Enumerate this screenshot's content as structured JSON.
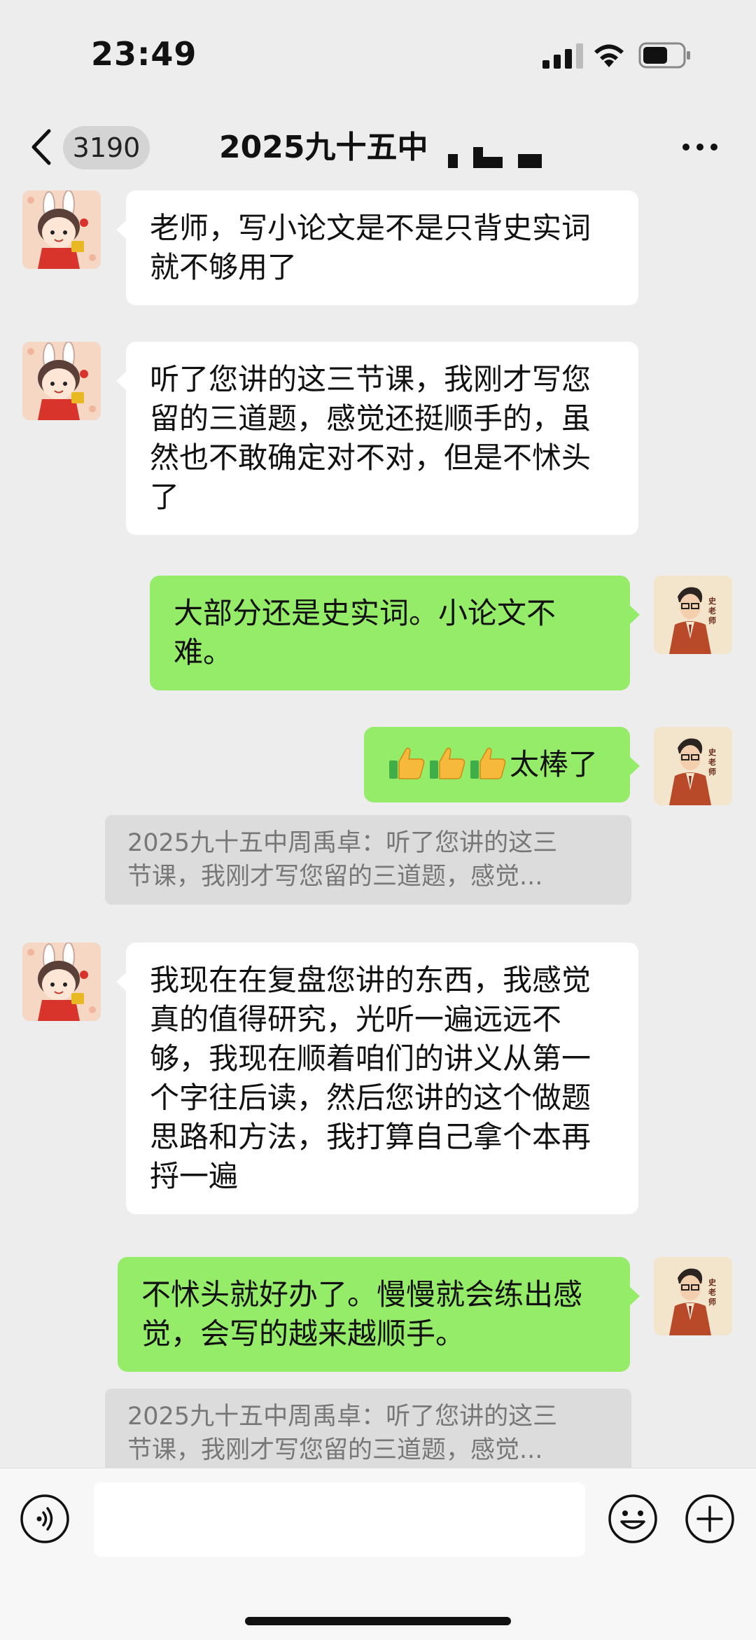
{
  "status_bar": {
    "time": "23:49"
  },
  "header": {
    "unread_count": "3190",
    "title": "2025九十五中"
  },
  "messages": [
    {
      "sender": "student",
      "text": "老师，写小论文是不是只背史实词就不够用了"
    },
    {
      "sender": "student",
      "text": "听了您讲的这三节课，我刚才写您留的三道题，感觉还挺顺手的，虽然也不敢确定对不对，但是不怵头了"
    },
    {
      "sender": "teacher",
      "text": "大部分还是史实词。小论文不难。"
    },
    {
      "sender": "teacher",
      "text": "太棒了",
      "emoji": [
        "thumbs-up",
        "thumbs-up",
        "thumbs-up"
      ]
    },
    {
      "quote": [
        "2025九十五中周禹卓：听了您讲的这三",
        "节课，我刚才写您留的三道题，感觉..."
      ]
    },
    {
      "sender": "student",
      "text": "我现在在复盘您讲的东西，我感觉真的值得研究，光听一遍远远不够，我现在顺着咱们的讲义从第一个字往后读，然后您讲的这个做题思路和方法，我打算自己拿个本再捋一遍"
    },
    {
      "sender": "teacher",
      "text": "不怵头就好办了。慢慢就会练出感觉，会写的越来越顺手。"
    },
    {
      "quote": [
        "2025九十五中周禹卓：听了您讲的这三",
        "节课，我刚才写您留的三道题，感觉..."
      ]
    }
  ],
  "teacher_avatar_label": "史老师",
  "input": {
    "value": ""
  },
  "colors": {
    "background": "#ededed",
    "outgoing_bubble": "#95ec69",
    "incoming_bubble": "#ffffff",
    "quote_bg": "#dcdcdc"
  }
}
